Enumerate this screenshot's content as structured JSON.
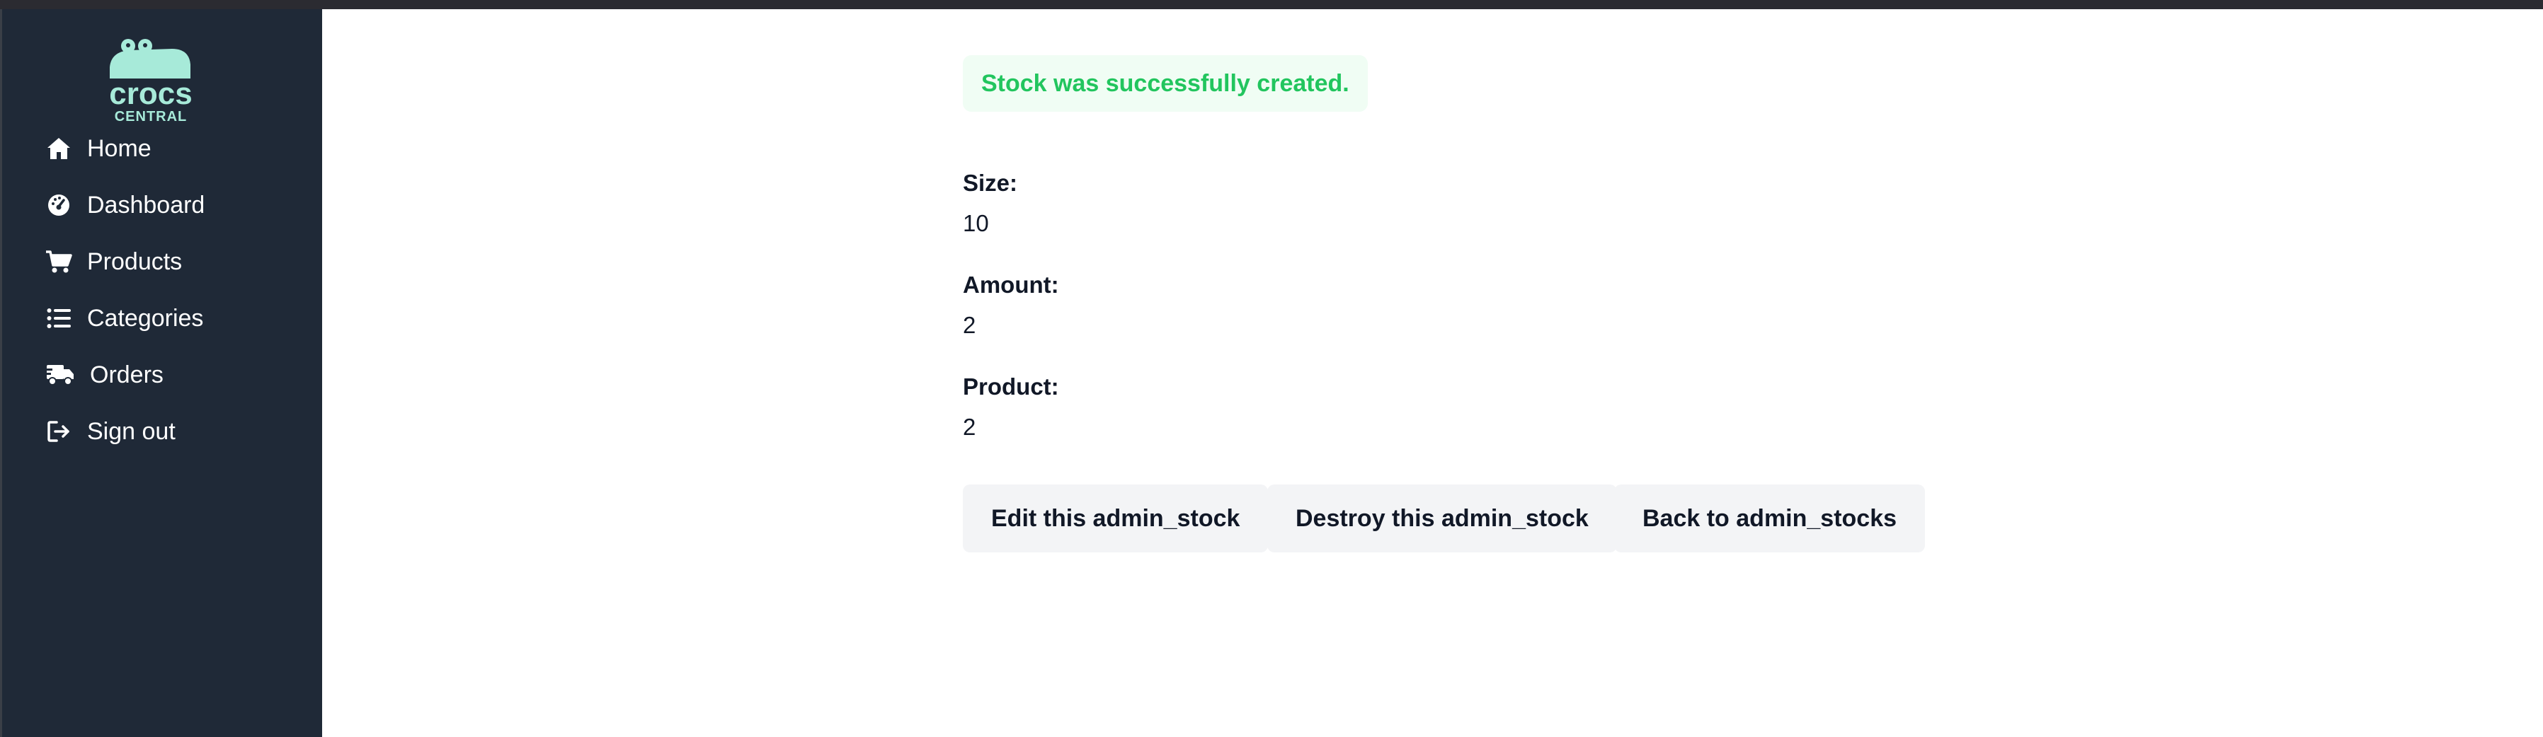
{
  "brand": {
    "line1": "crocs",
    "line2": "CENTRAL",
    "accent": "#a7ead9"
  },
  "sidebar": {
    "items": [
      {
        "label": "Home",
        "icon": "home-icon"
      },
      {
        "label": "Dashboard",
        "icon": "dashboard-icon"
      },
      {
        "label": "Products",
        "icon": "cart-icon"
      },
      {
        "label": "Categories",
        "icon": "list-icon"
      },
      {
        "label": "Orders",
        "icon": "truck-icon"
      },
      {
        "label": "Sign out",
        "icon": "sign-out-icon"
      }
    ]
  },
  "notice": {
    "text": "Stock was successfully created.",
    "color": "#22c55e"
  },
  "stock": {
    "size_label": "Size:",
    "size_value": "10",
    "amount_label": "Amount:",
    "amount_value": "2",
    "product_label": "Product:",
    "product_value": "2"
  },
  "actions": {
    "edit_label": "Edit this admin_stock",
    "destroy_label": "Destroy this admin_stock",
    "back_label": "Back to admin_stocks"
  }
}
